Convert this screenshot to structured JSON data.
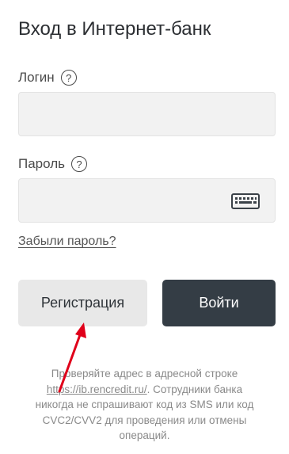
{
  "header": {
    "title": "Вход в Интернет-банк"
  },
  "login": {
    "label": "Логин",
    "help": "?",
    "value": "",
    "placeholder": ""
  },
  "password": {
    "label": "Пароль",
    "help": "?",
    "value": "",
    "placeholder": ""
  },
  "links": {
    "forgot_password": "Забыли пароль?"
  },
  "buttons": {
    "register": "Регистрация",
    "login": "Войти"
  },
  "notice": {
    "prefix": "Проверяйте адрес в адресной строке",
    "url": "https://ib.rencredit.ru/",
    "suffix": ". Сотрудники банка никогда не спрашивают код из SMS или код CVC2/CVV2 для проведения или отмены операций."
  },
  "colors": {
    "primary_button": "#343d45",
    "secondary_button": "#e8e8e8",
    "annotation_arrow": "#e0001a"
  },
  "icons": {
    "password_keyboard": "keyboard-icon",
    "annotation": "red-arrow"
  }
}
